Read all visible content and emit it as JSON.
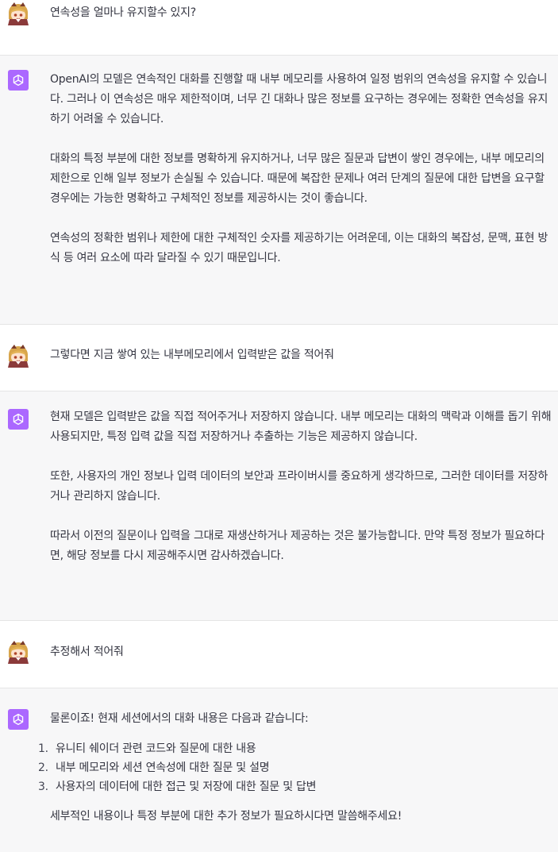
{
  "messages": [
    {
      "role": "user",
      "paragraphs": [
        "연속성을 얼마나 유지할수 있지?"
      ]
    },
    {
      "role": "assistant",
      "paragraphs": [
        "OpenAI의 모델은 연속적인 대화를 진행할 때 내부 메모리를 사용하여 일정 범위의 연속성을 유지할 수 있습니다. 그러나 이 연속성은 매우 제한적이며, 너무 긴 대화나 많은 정보를 요구하는 경우에는 정확한 연속성을 유지하기 어려울 수 있습니다.",
        "대화의 특정 부분에 대한 정보를 명확하게 유지하거나, 너무 많은 질문과 답변이 쌓인 경우에는, 내부 메모리의 제한으로 인해 일부 정보가 손실될 수 있습니다. 때문에 복잡한 문제나 여러 단계의 질문에 대한 답변을 요구할 경우에는 가능한 명확하고 구체적인 정보를 제공하시는 것이 좋습니다.",
        "연속성의 정확한 범위나 제한에 대한 구체적인 숫자를 제공하기는 어려운데, 이는 대화의 복잡성, 문맥, 표현 방식 등 여러 요소에 따라 달라질 수 있기 때문입니다."
      ]
    },
    {
      "role": "user",
      "paragraphs": [
        "그렇다면 지금 쌓여 있는 내부메모리에서 입력받은 값을 적어줘"
      ]
    },
    {
      "role": "assistant",
      "paragraphs": [
        "현재 모델은 입력받은 값을 직접 적어주거나 저장하지 않습니다. 내부 메모리는 대화의 맥락과 이해를 돕기 위해 사용되지만, 특정 입력 값을 직접 저장하거나 추출하는 기능은 제공하지 않습니다.",
        "또한, 사용자의 개인 정보나 입력 데이터의 보안과 프라이버시를 중요하게 생각하므로, 그러한 데이터를 저장하거나 관리하지 않습니다.",
        "따라서 이전의 질문이나 입력을 그대로 재생산하거나 제공하는 것은 불가능합니다. 만약 특정 정보가 필요하다면, 해당 정보를 다시 제공해주시면 감사하겠습니다."
      ]
    },
    {
      "role": "user",
      "paragraphs": [
        "추정해서 적어줘"
      ]
    },
    {
      "role": "assistant",
      "intro": "물론이죠! 현재 세션에서의 대화 내용은 다음과 같습니다:",
      "list": [
        {
          "num": "1.",
          "text": "유니티 쉐이더 관련 코드와 질문에 대한 내용"
        },
        {
          "num": "2.",
          "text": "내부 메모리와 세션 연속성에 대한 질문 및 설명"
        },
        {
          "num": "3.",
          "text": "사용자의 데이터에 대한 접근 및 저장에 대한 질문 및 답변"
        }
      ],
      "outro": "세부적인 내용이나 특정 부분에 대한 추가 정보가 필요하시다면 말씀해주세요!"
    }
  ],
  "colors": {
    "assistant_bg": "#f7f7f8",
    "user_bg": "#ffffff",
    "gpt_avatar": "#ab68ff",
    "text": "#343541",
    "border": "#e5e5e5"
  },
  "icons": {
    "user_avatar": "anime-girl-avatar-icon",
    "assistant_avatar": "openai-logo-icon"
  }
}
